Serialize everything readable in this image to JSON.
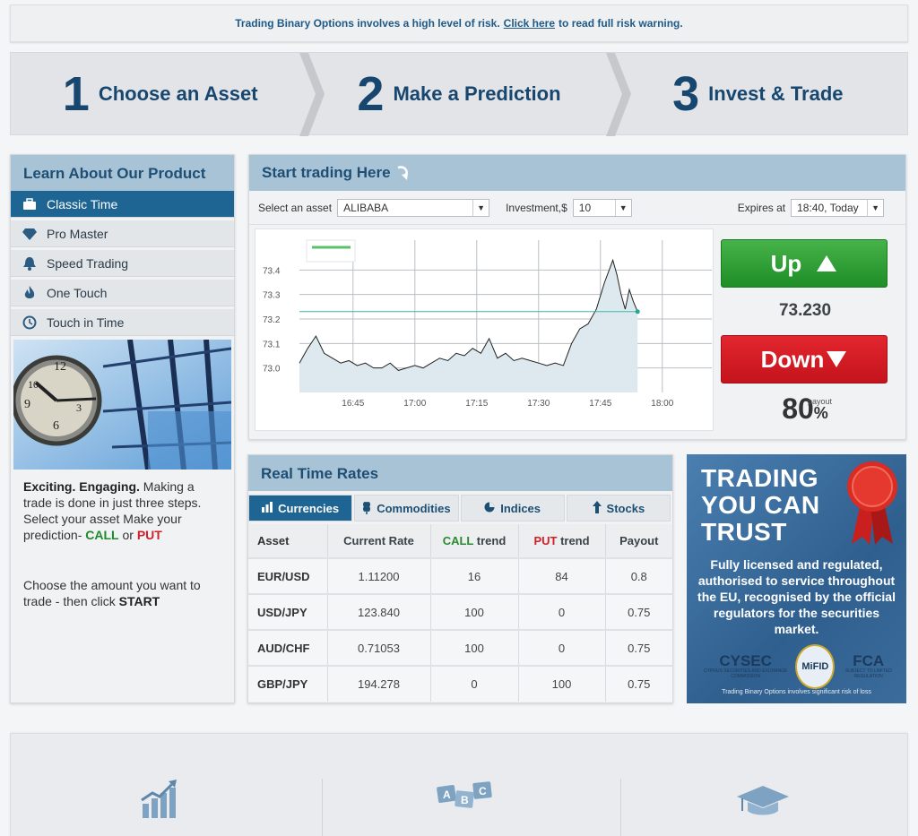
{
  "risk": {
    "before": "Trading Binary Options involves a high level of risk.",
    "link": "Click here",
    "after": "to read full risk warning."
  },
  "steps": [
    {
      "num": "1",
      "label": "Choose an Asset"
    },
    {
      "num": "2",
      "label": "Make a Prediction"
    },
    {
      "num": "3",
      "label": "Invest & Trade"
    }
  ],
  "learn": {
    "title": "Learn About Our Product",
    "items": [
      {
        "label": "Classic Time",
        "icon": "briefcase-icon"
      },
      {
        "label": "Pro Master",
        "icon": "diamond-icon"
      },
      {
        "label": "Speed Trading",
        "icon": "bell-icon"
      },
      {
        "label": "One Touch",
        "icon": "flame-icon"
      },
      {
        "label": "Touch in Time",
        "icon": "clock-icon"
      }
    ],
    "text1_bold": "Exciting. Engaging.",
    "text1_rest": " Making a trade is done in just three steps. Select your asset Make your prediction-",
    "call": "CALL",
    "or": "or",
    "put": "PUT",
    "text2": "Choose the amount you want to trade - then click",
    "start": "START"
  },
  "trade": {
    "title": "Start trading Here",
    "asset_label": "Select an asset",
    "asset_value": "ALIBABA",
    "investment_label": "Investment,$",
    "investment_value": "10",
    "expires_label": "Expires at",
    "expires_value": "18:40, Today",
    "up_label": "Up",
    "down_label": "Down",
    "rate": "73.230",
    "payout_value": "80",
    "payout_pct": "%",
    "payout_label": "payout"
  },
  "chart_data": {
    "type": "line",
    "title": "",
    "xlabel": "",
    "ylabel": "",
    "x_ticks": [
      "16:45",
      "17:00",
      "17:15",
      "17:30",
      "17:45",
      "18:00"
    ],
    "y_ticks": [
      "73.4",
      "73.3",
      "73.2",
      "73.1",
      "73.0"
    ],
    "ylim": [
      72.9,
      73.5
    ],
    "current_rate": 73.23,
    "series": [
      {
        "x": [
          "16:32",
          "16:34",
          "16:36",
          "16:38",
          "16:40",
          "16:42",
          "16:44",
          "16:46",
          "16:48",
          "16:50",
          "16:52",
          "16:54",
          "16:56",
          "16:58",
          "17:00",
          "17:02",
          "17:04",
          "17:06",
          "17:08",
          "17:10",
          "17:12",
          "17:14",
          "17:16",
          "17:18",
          "17:20",
          "17:22",
          "17:24",
          "17:26",
          "17:28",
          "17:30",
          "17:32",
          "17:34",
          "17:36",
          "17:38",
          "17:40",
          "17:42",
          "17:44",
          "17:46",
          "17:48",
          "17:49",
          "17:50",
          "17:51",
          "17:52",
          "17:53",
          "17:54"
        ],
        "values": [
          73.02,
          73.08,
          73.13,
          73.06,
          73.04,
          73.02,
          73.03,
          73.01,
          73.02,
          73.0,
          73.0,
          73.02,
          72.99,
          73.0,
          73.01,
          73.0,
          73.02,
          73.04,
          73.03,
          73.06,
          73.05,
          73.08,
          73.06,
          73.12,
          73.04,
          73.06,
          73.03,
          73.04,
          73.03,
          73.02,
          73.01,
          73.02,
          73.01,
          73.1,
          73.16,
          73.18,
          73.24,
          73.35,
          73.44,
          73.38,
          73.3,
          73.24,
          73.32,
          73.27,
          73.23
        ]
      }
    ],
    "grid": true
  },
  "rates": {
    "title": "Real Time Rates",
    "tabs": [
      {
        "label": "Currencies",
        "icon": "bar-chart-icon"
      },
      {
        "label": "Commodities",
        "icon": "wheat-icon"
      },
      {
        "label": "Indices",
        "icon": "pie-chart-icon"
      },
      {
        "label": "Stocks",
        "icon": "arrow-up-icon"
      }
    ],
    "headers": {
      "asset": "Asset",
      "rate": "Current Rate",
      "call": "CALL",
      "put": "PUT",
      "trend": "trend",
      "payout": "Payout"
    },
    "rows": [
      {
        "asset": "EUR/USD",
        "rate": "1.11200",
        "call": "16",
        "put": "84",
        "payout": "0.8",
        "call_color": "g",
        "put_color": "r"
      },
      {
        "asset": "USD/JPY",
        "rate": "123.840",
        "call": "100",
        "put": "0",
        "payout": "0.75",
        "call_color": "",
        "put_color": ""
      },
      {
        "asset": "AUD/CHF",
        "rate": "0.71053",
        "call": "100",
        "put": "0",
        "payout": "0.75",
        "call_color": "",
        "put_color": "r"
      },
      {
        "asset": "GBP/JPY",
        "rate": "194.278",
        "call": "0",
        "put": "100",
        "payout": "0.75",
        "call_color": "",
        "put_color": ""
      }
    ]
  },
  "trust": {
    "line1": "TRADING",
    "line2": "YOU CAN",
    "line3": "TRUST",
    "text": "Fully licensed and regulated, authorised to service throughout the EU, recognised by the official regulators for the securities market.",
    "cysec": "CYSEC",
    "cysec_sub": "CYPRUS SECURITIES AND EXCHANGE COMMISSION",
    "mifid": "MiFID",
    "fca": "FCA",
    "fca_sub": "SUBJECT TO LIMITED REGULATION",
    "footer": "Trading Binary Options involves significant risk of loss"
  },
  "colors": {
    "accent": "#1e6593",
    "header_bg": "#a9c3d6",
    "title": "#1d4f75",
    "up": "#2a9a2f",
    "down": "#d3181f"
  }
}
